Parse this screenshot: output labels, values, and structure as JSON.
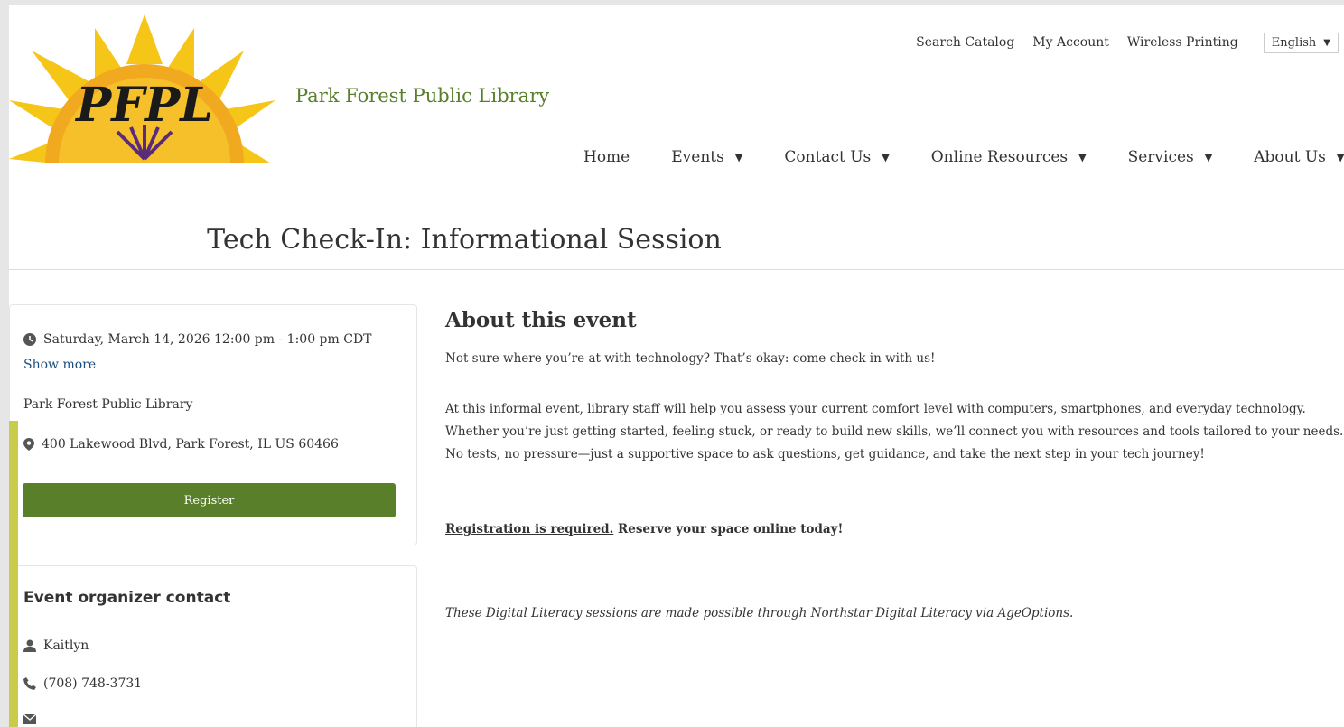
{
  "header": {
    "site_name": "Park Forest Public Library",
    "logo_text": "PFPL",
    "utility_links": [
      "Search Catalog",
      "My Account",
      "Wireless Printing"
    ],
    "language": "English"
  },
  "nav": {
    "home": "Home",
    "events": "Events",
    "contact": "Contact Us",
    "resources": "Online Resources",
    "services": "Services",
    "about": "About Us"
  },
  "event": {
    "title": "Tech Check-In: Informational Session",
    "datetime": "Saturday, March 14, 2026 12:00 pm - 1:00 pm CDT",
    "show_more": "Show more",
    "location_name": "Park Forest Public Library",
    "address": "400 Lakewood Blvd, Park Forest, IL US 60466",
    "register_label": "Register"
  },
  "organizer": {
    "title": "Event organizer contact",
    "name": "Kaitlyn",
    "phone": "(708) 748-3731"
  },
  "about": {
    "heading": "About this event",
    "p1": "Not sure where you’re at with technology? That’s okay: come check in with us!",
    "p2": "At this informal event, library staff will help you assess your current comfort level with computers, smartphones, and everyday technology. Whether you’re just getting started, feeling stuck, or ready to build new skills, we’ll connect you with resources and tools tailored to your needs. No tests, no pressure—just a supportive space to ask questions, get guidance, and take the next step in your tech journey!",
    "registration_link": "Registration is required.",
    "registration_rest": " Reserve your space online today!",
    "credit": "These Digital Literacy sessions are made possible through Northstar Digital Literacy via AgeOptions."
  },
  "colors": {
    "brand_green": "#5a7f2b",
    "sun_yellow": "#f5b800",
    "link_blue": "#1a4e7a"
  },
  "icons": [
    "clock-icon",
    "map-pin-icon",
    "person-icon",
    "phone-icon",
    "envelope-icon",
    "caret-down-icon"
  ]
}
